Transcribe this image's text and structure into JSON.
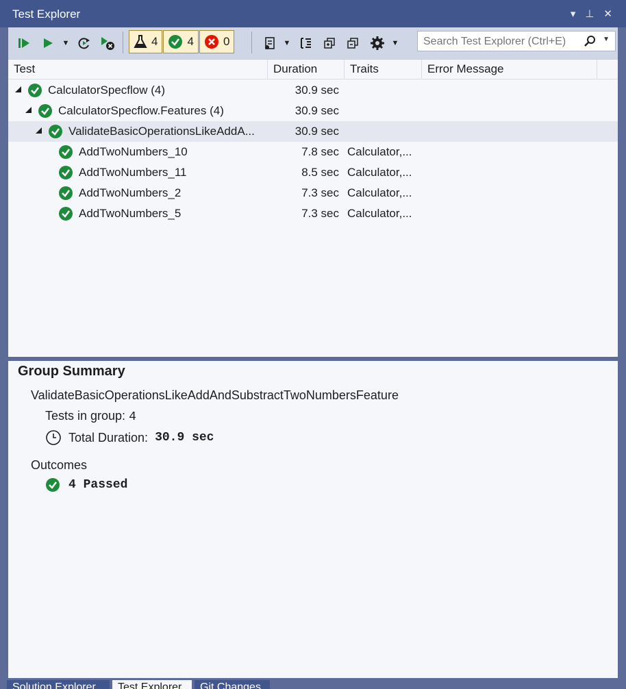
{
  "window": {
    "title": "Test Explorer",
    "title_icons": [
      "dropdown-icon",
      "pin-icon",
      "close-icon"
    ]
  },
  "toolbar": {
    "badges": {
      "total": "4",
      "passed": "4",
      "failed": "0"
    },
    "search_placeholder": "Search Test Explorer (Ctrl+E)"
  },
  "columns": {
    "test": "Test",
    "duration": "Duration",
    "traits": "Traits",
    "error": "Error Message"
  },
  "tree": [
    {
      "name": "CalculatorSpecflow",
      "count": "(4)",
      "duration": "30.9 sec",
      "traits": ""
    },
    {
      "name": "CalculatorSpecflow.Features",
      "count": "(4)",
      "duration": "30.9 sec",
      "traits": ""
    },
    {
      "name": "ValidateBasicOperationsLikeAddA...",
      "count": "",
      "duration": "30.9 sec",
      "traits": ""
    },
    {
      "name": "AddTwoNumbers_10",
      "count": "",
      "duration": "7.8 sec",
      "traits": "Calculator,..."
    },
    {
      "name": "AddTwoNumbers_11",
      "count": "",
      "duration": "8.5 sec",
      "traits": "Calculator,..."
    },
    {
      "name": "AddTwoNumbers_2",
      "count": "",
      "duration": "7.3 sec",
      "traits": "Calculator,..."
    },
    {
      "name": "AddTwoNumbers_5",
      "count": "",
      "duration": "7.3 sec",
      "traits": "Calculator,..."
    }
  ],
  "summary": {
    "title": "Group Summary",
    "group_name": "ValidateBasicOperationsLikeAddAndSubstractTwoNumbersFeature",
    "tests_label": "Tests in group:",
    "tests_value": "4",
    "duration_label": "Total Duration:",
    "duration_value": "30.9 sec",
    "outcomes_label": "Outcomes",
    "passed_text": "4 Passed"
  },
  "bottom_tabs": [
    "Solution Explorer",
    "Test Explorer",
    "Git Changes"
  ],
  "colors": {
    "accent": "#40568d",
    "pass": "#1e8a3c",
    "fail": "#e51400",
    "badge_bg": "#fdf2d0"
  }
}
